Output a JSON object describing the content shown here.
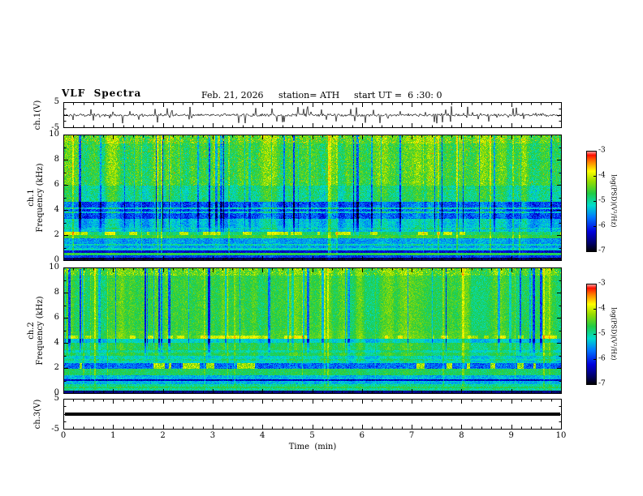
{
  "header": {
    "title": "VLF  Spectra",
    "date": "Feb. 21, 2026",
    "station": "station= ATH",
    "start_ut": "start UT =  6 :30: 0"
  },
  "panels": {
    "wave": {
      "label": "ch.1(V)",
      "yticks": [
        "5",
        "-5"
      ]
    },
    "spec1": {
      "label_line1": "ch.1",
      "label_line2": "Frequency (kHz)",
      "yticks": [
        "10",
        "8",
        "6",
        "4",
        "2",
        "0"
      ]
    },
    "spec2": {
      "label_line1": "ch.2",
      "label_line2": "Frequency (kHz)",
      "yticks": [
        "10",
        "8",
        "6",
        "4",
        "2",
        "0"
      ]
    },
    "ch3": {
      "label": "ch.3(V)",
      "yticks": [
        "5",
        "-5"
      ]
    }
  },
  "xaxis": {
    "label": "Time  (min)",
    "ticks": [
      "0",
      "1",
      "2",
      "3",
      "4",
      "5",
      "6",
      "7",
      "8",
      "9",
      "10"
    ]
  },
  "colorbar": {
    "label": "log(PSD)(V²/Hz)",
    "ticks": [
      "-3",
      "-4",
      "-5",
      "-6",
      "-7"
    ],
    "palette": [
      {
        "pos": 0.0,
        "color": "#000000"
      },
      {
        "pos": 0.08,
        "color": "#000066"
      },
      {
        "pos": 0.2,
        "color": "#0000dd"
      },
      {
        "pos": 0.34,
        "color": "#0077ff"
      },
      {
        "pos": 0.46,
        "color": "#00ddcc"
      },
      {
        "pos": 0.58,
        "color": "#22cc44"
      },
      {
        "pos": 0.7,
        "color": "#99dd00"
      },
      {
        "pos": 0.8,
        "color": "#ffff00"
      },
      {
        "pos": 0.9,
        "color": "#ff7700"
      },
      {
        "pos": 0.96,
        "color": "#ff1100"
      },
      {
        "pos": 1.0,
        "color": "#ffaaaa"
      }
    ]
  },
  "chart_data": [
    {
      "type": "line",
      "name": "ch1_waveform",
      "panel_label": "ch.1(V)",
      "xlim": [
        0,
        10
      ],
      "ylim": [
        -5,
        5
      ],
      "description": "Dense broadband noise waveform around 0 V with frequent impulsive spikes up to roughly ±4 V across the full 10 minutes"
    },
    {
      "type": "heatmap",
      "name": "ch1_spectrogram",
      "panel_label": "ch.1 Frequency (kHz)",
      "xlabel": "Time (min)",
      "ylabel": "Frequency (kHz)",
      "xlim": [
        0,
        10
      ],
      "ylim": [
        0,
        10
      ],
      "zlim": [
        -7,
        -3
      ],
      "zlabel": "log(PSD)(V²/Hz)",
      "column_jitter": 0.3,
      "bands": [
        {
          "f": [
            9.3,
            10.0
          ],
          "psd": -4.4,
          "noise": 0.55
        },
        {
          "f": [
            6.0,
            9.3
          ],
          "psd": -4.55,
          "noise": 0.5
        },
        {
          "f": [
            4.7,
            6.0
          ],
          "psd": -4.85,
          "noise": 0.45
        },
        {
          "f": [
            3.3,
            4.7
          ],
          "psd": -5.75,
          "noise": 0.5
        },
        {
          "f": [
            2.3,
            3.3
          ],
          "psd": -5.25,
          "noise": 0.4
        },
        {
          "f": [
            2.05,
            2.3
          ],
          "psd": -4.8,
          "noise": 0.3,
          "segments": {
            "psd": -4.0,
            "threshold": 0.63
          }
        },
        {
          "f": [
            1.75,
            2.05
          ],
          "psd": -4.6,
          "noise": 0.3
        },
        {
          "f": [
            1.0,
            1.75
          ],
          "psd": -5.45,
          "noise": 0.4
        },
        {
          "f": [
            0.62,
            1.0
          ],
          "psd": -6.2,
          "noise": 0.35
        },
        {
          "f": [
            0.42,
            0.62
          ],
          "psd": -4.7,
          "noise": 0.3
        },
        {
          "f": [
            0.22,
            0.42
          ],
          "psd": -5.9,
          "noise": 0.3
        },
        {
          "f": [
            0.0,
            0.22
          ],
          "psd": -6.75,
          "noise": 0.2
        }
      ],
      "lines": [
        {
          "f": 5.62,
          "psd": -4.8
        },
        {
          "f": 4.15,
          "psd": -5.05
        },
        {
          "f": 3.82,
          "psd": -5.15
        },
        {
          "f": 2.55,
          "psd": -5.05
        },
        {
          "f": 1.28,
          "psd": -5.05
        },
        {
          "f": 0.9,
          "psd": -5.15
        }
      ],
      "vertical_streaks": {
        "dark": {
          "prob": 0.045,
          "psd": -1.35,
          "f_min": 3.2
        },
        "bright": {
          "prob": 0.032,
          "psd": 0.65
        }
      },
      "speckle": [
        {
          "f_min": 9.3,
          "prob": 0.06,
          "psd": -3.6
        },
        {
          "f_min": 6.0,
          "prob": 0.004,
          "psd": -3.4
        }
      ]
    },
    {
      "type": "heatmap",
      "name": "ch2_spectrogram",
      "panel_label": "ch.2 Frequency (kHz)",
      "xlabel": "Time (min)",
      "ylabel": "Frequency (kHz)",
      "xlim": [
        0,
        10
      ],
      "ylim": [
        0,
        10
      ],
      "zlim": [
        -7,
        -3
      ],
      "zlabel": "log(PSD)(V²/Hz)",
      "column_jitter": 0.25,
      "bands": [
        {
          "f": [
            9.4,
            10.0
          ],
          "psd": -4.4,
          "noise": 0.5
        },
        {
          "f": [
            5.0,
            9.4
          ],
          "psd": -4.6,
          "noise": 0.35
        },
        {
          "f": [
            4.6,
            5.0
          ],
          "psd": -4.5,
          "noise": 0.3
        },
        {
          "f": [
            4.35,
            4.6
          ],
          "psd": -4.45,
          "noise": 0.3,
          "segments": {
            "psd": -3.95,
            "threshold": 0.55
          }
        },
        {
          "f": [
            4.05,
            4.35
          ],
          "psd": -5.15,
          "noise": 0.3
        },
        {
          "f": [
            3.0,
            4.05
          ],
          "psd": -4.7,
          "noise": 0.3
        },
        {
          "f": [
            2.45,
            3.0
          ],
          "psd": -5.1,
          "noise": 0.35
        },
        {
          "f": [
            1.95,
            2.45
          ],
          "psd": -5.7,
          "noise": 0.5,
          "segments": {
            "psd": -4.15,
            "threshold": 0.67
          }
        },
        {
          "f": [
            1.45,
            1.95
          ],
          "psd": -4.75,
          "noise": 0.3
        },
        {
          "f": [
            0.75,
            1.45
          ],
          "psd": -5.35,
          "noise": 0.4
        },
        {
          "f": [
            0.2,
            0.75
          ],
          "psd": -4.95,
          "noise": 0.35
        },
        {
          "f": [
            0.0,
            0.2
          ],
          "psd": -6.6,
          "noise": 0.2
        }
      ],
      "lines": [
        {
          "f": 3.35,
          "psd": -4.95
        },
        {
          "f": 2.7,
          "psd": -4.9
        },
        {
          "f": 1.05,
          "psd": -6.3
        },
        {
          "f": 0.5,
          "psd": -4.7
        }
      ],
      "vertical_streaks": {
        "dark": {
          "prob": 0.06,
          "psd": -1.5,
          "f_min": 4.3
        },
        "bright": {
          "prob": 0.025,
          "psd": 0.5
        }
      },
      "speckle": [
        {
          "f_min": 9.4,
          "prob": 0.05,
          "psd": -3.9
        }
      ]
    },
    {
      "type": "line",
      "name": "ch3_waveform",
      "panel_label": "ch.3(V)",
      "xlim": [
        0,
        10
      ],
      "ylim": [
        -5,
        5
      ],
      "description": "Constant flat thick black line at 0 V (no signal on channel 3)"
    }
  ]
}
